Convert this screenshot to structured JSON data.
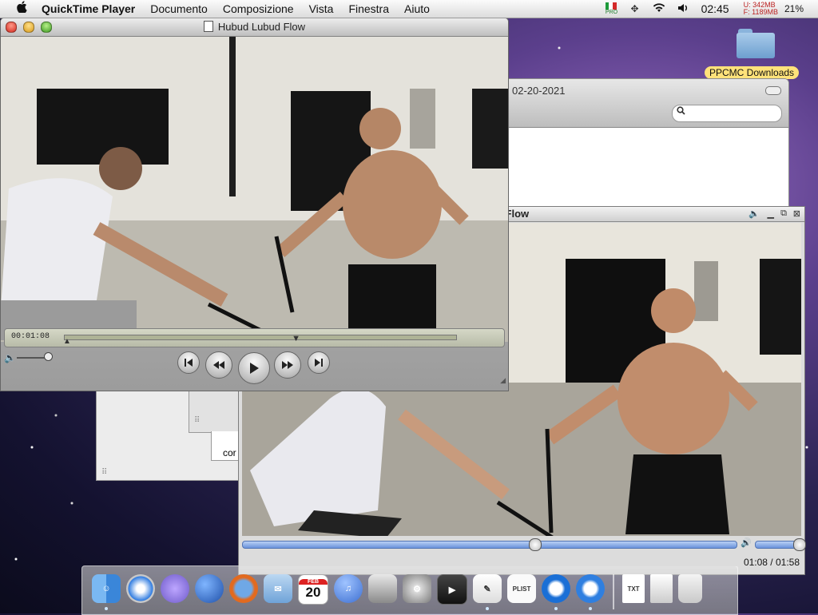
{
  "menubar": {
    "apple": "",
    "app_name": "QuickTime Player",
    "menus": [
      "Documento",
      "Composizione",
      "Vista",
      "Finestra",
      "Aiuto"
    ],
    "flag_label": "PRO",
    "mem_used": "U:  342MB",
    "mem_free": "F: 1189MB",
    "clock": "02:45",
    "battery": "21%"
  },
  "desktop": {
    "folder_label": "PPCMC Downloads"
  },
  "finder_window": {
    "title": "02-20-2021"
  },
  "background_fragment": {
    "text": "cor"
  },
  "qt_main": {
    "title": "Hubud Lubud Flow",
    "timecode": "00:01:08",
    "playhead_position": 0.59
  },
  "qt_secondary": {
    "title": "d Flow",
    "time_display": "01:08 / 01:58",
    "progress": 0.59,
    "volume": 1.0
  },
  "dock": {
    "icons": [
      "finder-icon",
      "safari-icon",
      "adium-icon",
      "network-icon",
      "firefox-icon",
      "mail-icon",
      "calendar-icon",
      "itunes-icon",
      "dashboard-icon",
      "system-preferences-icon",
      "front-row-icon",
      "preview-icon",
      "plist-editor-icon",
      "quicktime-icon",
      "quicktime-player-icon",
      "text-file-icon",
      "document-icon",
      "trash-icon"
    ],
    "calendar_month": "FEB",
    "calendar_day": "20",
    "colors": {
      "finder": "#3a86d9",
      "safari": "#2f7be0",
      "adium": "#6d59c9",
      "network": "#2a64c8",
      "firefox": "#e26a1f",
      "mail": "#6fa3d8",
      "itunes": "#3d6fd1",
      "quicktime": "#1a6fd6",
      "trash": "#c9c9c9"
    }
  }
}
